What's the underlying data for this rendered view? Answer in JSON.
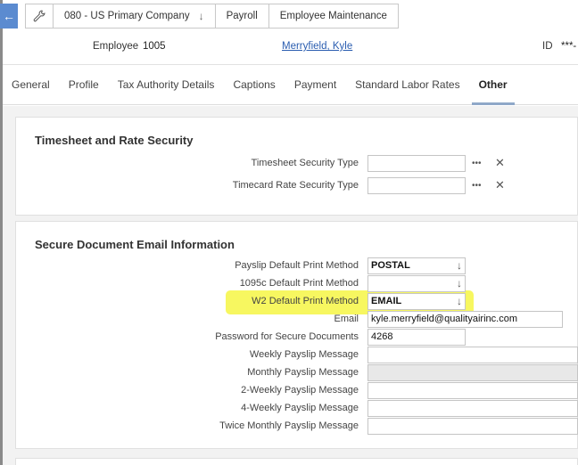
{
  "breadcrumb": {
    "company": "080 - US Primary Company",
    "module": "Payroll",
    "page": "Employee Maintenance"
  },
  "header": {
    "employee_label": "Employee",
    "employee_id": "1005",
    "employee_name": "Merryfield, Kyle",
    "id_label": "ID",
    "id_value": "***-"
  },
  "tabs": [
    "General",
    "Profile",
    "Tax Authority Details",
    "Captions",
    "Payment",
    "Standard Labor Rates",
    "Other"
  ],
  "active_tab": "Other",
  "timesheet_section": {
    "title": "Timesheet and Rate Security",
    "timesheet_security_label": "Timesheet Security Type",
    "timesheet_security_value": "",
    "timecard_rate_label": "Timecard Rate Security Type",
    "timecard_rate_value": "",
    "more_glyph": "•••",
    "clear_glyph": "✕"
  },
  "email_section": {
    "title": "Secure Document Email Information",
    "payslip_label": "Payslip Default Print Method",
    "payslip_value": "POSTAL",
    "c1095_label": "1095c Default Print Method",
    "c1095_value": "",
    "w2_label": "W2 Default Print Method",
    "w2_value": "EMAIL",
    "email_label": "Email",
    "email_value": "kyle.merryfield@qualityairinc.com",
    "password_label": "Password for Secure Documents",
    "password_value": "4268",
    "weekly_label": "Weekly Payslip Message",
    "monthly_label": "Monthly Payslip Message",
    "two_weekly_label": "2-Weekly Payslip Message",
    "four_weekly_label": "4-Weekly Payslip Message",
    "twice_monthly_label": "Twice Monthly Payslip Message"
  },
  "colors": {
    "accent": "#5b8bd0",
    "highlight": "#f7f760",
    "link": "#2a5db0"
  }
}
